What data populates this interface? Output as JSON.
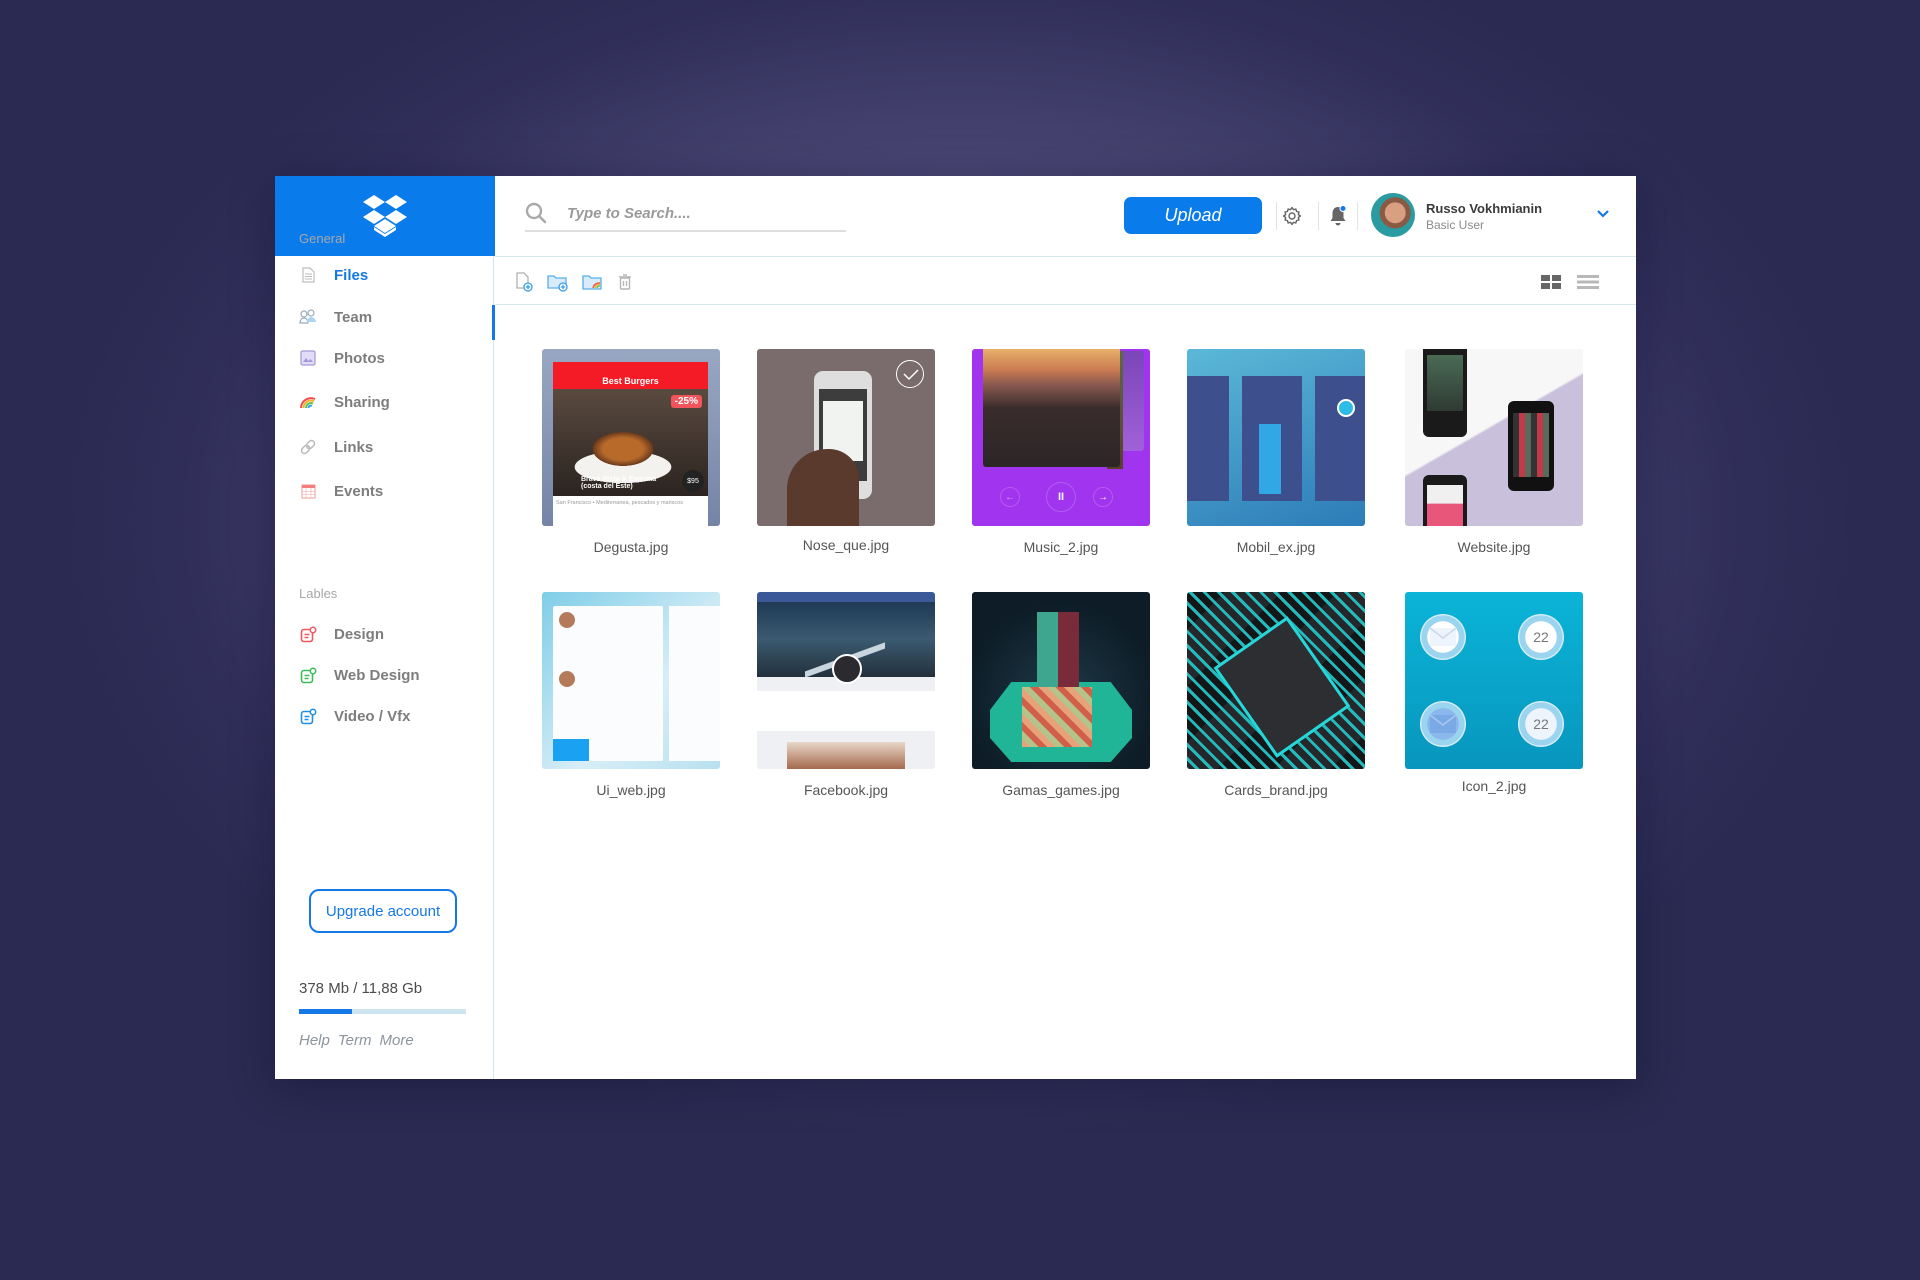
{
  "app": {
    "logo_icon": "dropbox-logo-icon"
  },
  "sidebar": {
    "general_label": "General",
    "general_items": [
      {
        "label": "Files",
        "icon": "file-icon",
        "active": true
      },
      {
        "label": "Team",
        "icon": "team-icon"
      },
      {
        "label": "Photos",
        "icon": "photo-icon"
      },
      {
        "label": "Sharing",
        "icon": "rainbow-icon"
      },
      {
        "label": "Links",
        "icon": "link-icon"
      },
      {
        "label": "Events",
        "icon": "calendar-icon"
      }
    ],
    "labels_label": "Lables",
    "label_items": [
      {
        "label": "Design",
        "icon": "tag-icon",
        "color": "#f0575e"
      },
      {
        "label": "Web Design",
        "icon": "tag-icon",
        "color": "#3dbb5a"
      },
      {
        "label": "Video / Vfx",
        "icon": "tag-icon",
        "color": "#1e8fe8"
      }
    ],
    "upgrade_label": "Upgrade account",
    "storage_text": "378 Mb / 11,88 Gb",
    "storage_used_percent": 32,
    "footer_links": [
      "Help",
      "Term",
      "More"
    ]
  },
  "header": {
    "search_placeholder": "Type to Search....",
    "search_value": "",
    "upload_label": "Upload",
    "settings_icon": "gear-icon",
    "notifications_icon": "bell-icon",
    "notification_dot_color": "#1479e6",
    "user_name": "Russo Vokhmianin",
    "user_role": "Basic User"
  },
  "toolbar": {
    "actions": [
      "new-file-icon",
      "new-folder-icon",
      "shared-folder-icon",
      "trash-icon"
    ],
    "views": [
      "grid-view-icon",
      "list-view-icon"
    ],
    "active_view": "grid"
  },
  "files": [
    {
      "name": "Degusta.jpg",
      "selected": false
    },
    {
      "name": "Nose_que.jpg",
      "selected": true
    },
    {
      "name": "Music_2.jpg",
      "selected": false
    },
    {
      "name": "Mobil_ex.jpg",
      "selected": false
    },
    {
      "name": "Website.jpg",
      "selected": false
    },
    {
      "name": "Ui_web.jpg",
      "selected": false
    },
    {
      "name": "Facebook.jpg",
      "selected": false
    },
    {
      "name": "Gamas_games.jpg",
      "selected": false
    },
    {
      "name": "Cards_brand.jpg",
      "selected": false
    },
    {
      "name": "Icon_2.jpg",
      "selected": false
    }
  ],
  "thumbnail_text": {
    "degusta_title": "Best Burgers",
    "degusta_discount": "-25%",
    "degusta_place": "Brava Pizza & Espuma (costa del Este)",
    "degusta_price": "$95",
    "degusta_sub": "San Francisco • Mediterranea, pescados y mariscos",
    "icon_number": "22"
  },
  "colors": {
    "brand": "#0a7bea",
    "accent": "#1479e6"
  }
}
